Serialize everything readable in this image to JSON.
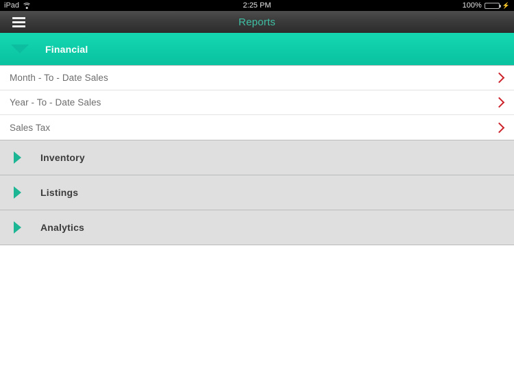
{
  "status_bar": {
    "device": "iPad",
    "wifi_icon": "wifi-icon",
    "time": "2:25 PM",
    "battery_percent": "100%",
    "battery_icon": "battery-icon",
    "charging_icon": "lightning-bolt-icon",
    "background": "#000000"
  },
  "nav_bar": {
    "menu_icon": "hamburger-menu-icon",
    "title": "Reports",
    "title_color": "#3fbfa3"
  },
  "colors": {
    "teal_accent": "#0ecaa6",
    "green_triangle": "#1db694",
    "red_chevron": "#cc2229",
    "section_gray": "#dfdfdf"
  },
  "sections": [
    {
      "label": "Financial",
      "expanded": true,
      "toggle_icon": "triangle-down-icon",
      "rows": [
        {
          "label": "Month - To - Date Sales",
          "chevron_icon": "chevron-right-icon"
        },
        {
          "label": "Year - To - Date Sales",
          "chevron_icon": "chevron-right-icon"
        },
        {
          "label": "Sales Tax",
          "chevron_icon": "chevron-right-icon"
        }
      ]
    },
    {
      "label": "Inventory",
      "expanded": false,
      "toggle_icon": "triangle-right-icon",
      "rows": []
    },
    {
      "label": "Listings",
      "expanded": false,
      "toggle_icon": "triangle-right-icon",
      "rows": []
    },
    {
      "label": "Analytics",
      "expanded": false,
      "toggle_icon": "triangle-right-icon",
      "rows": []
    }
  ]
}
